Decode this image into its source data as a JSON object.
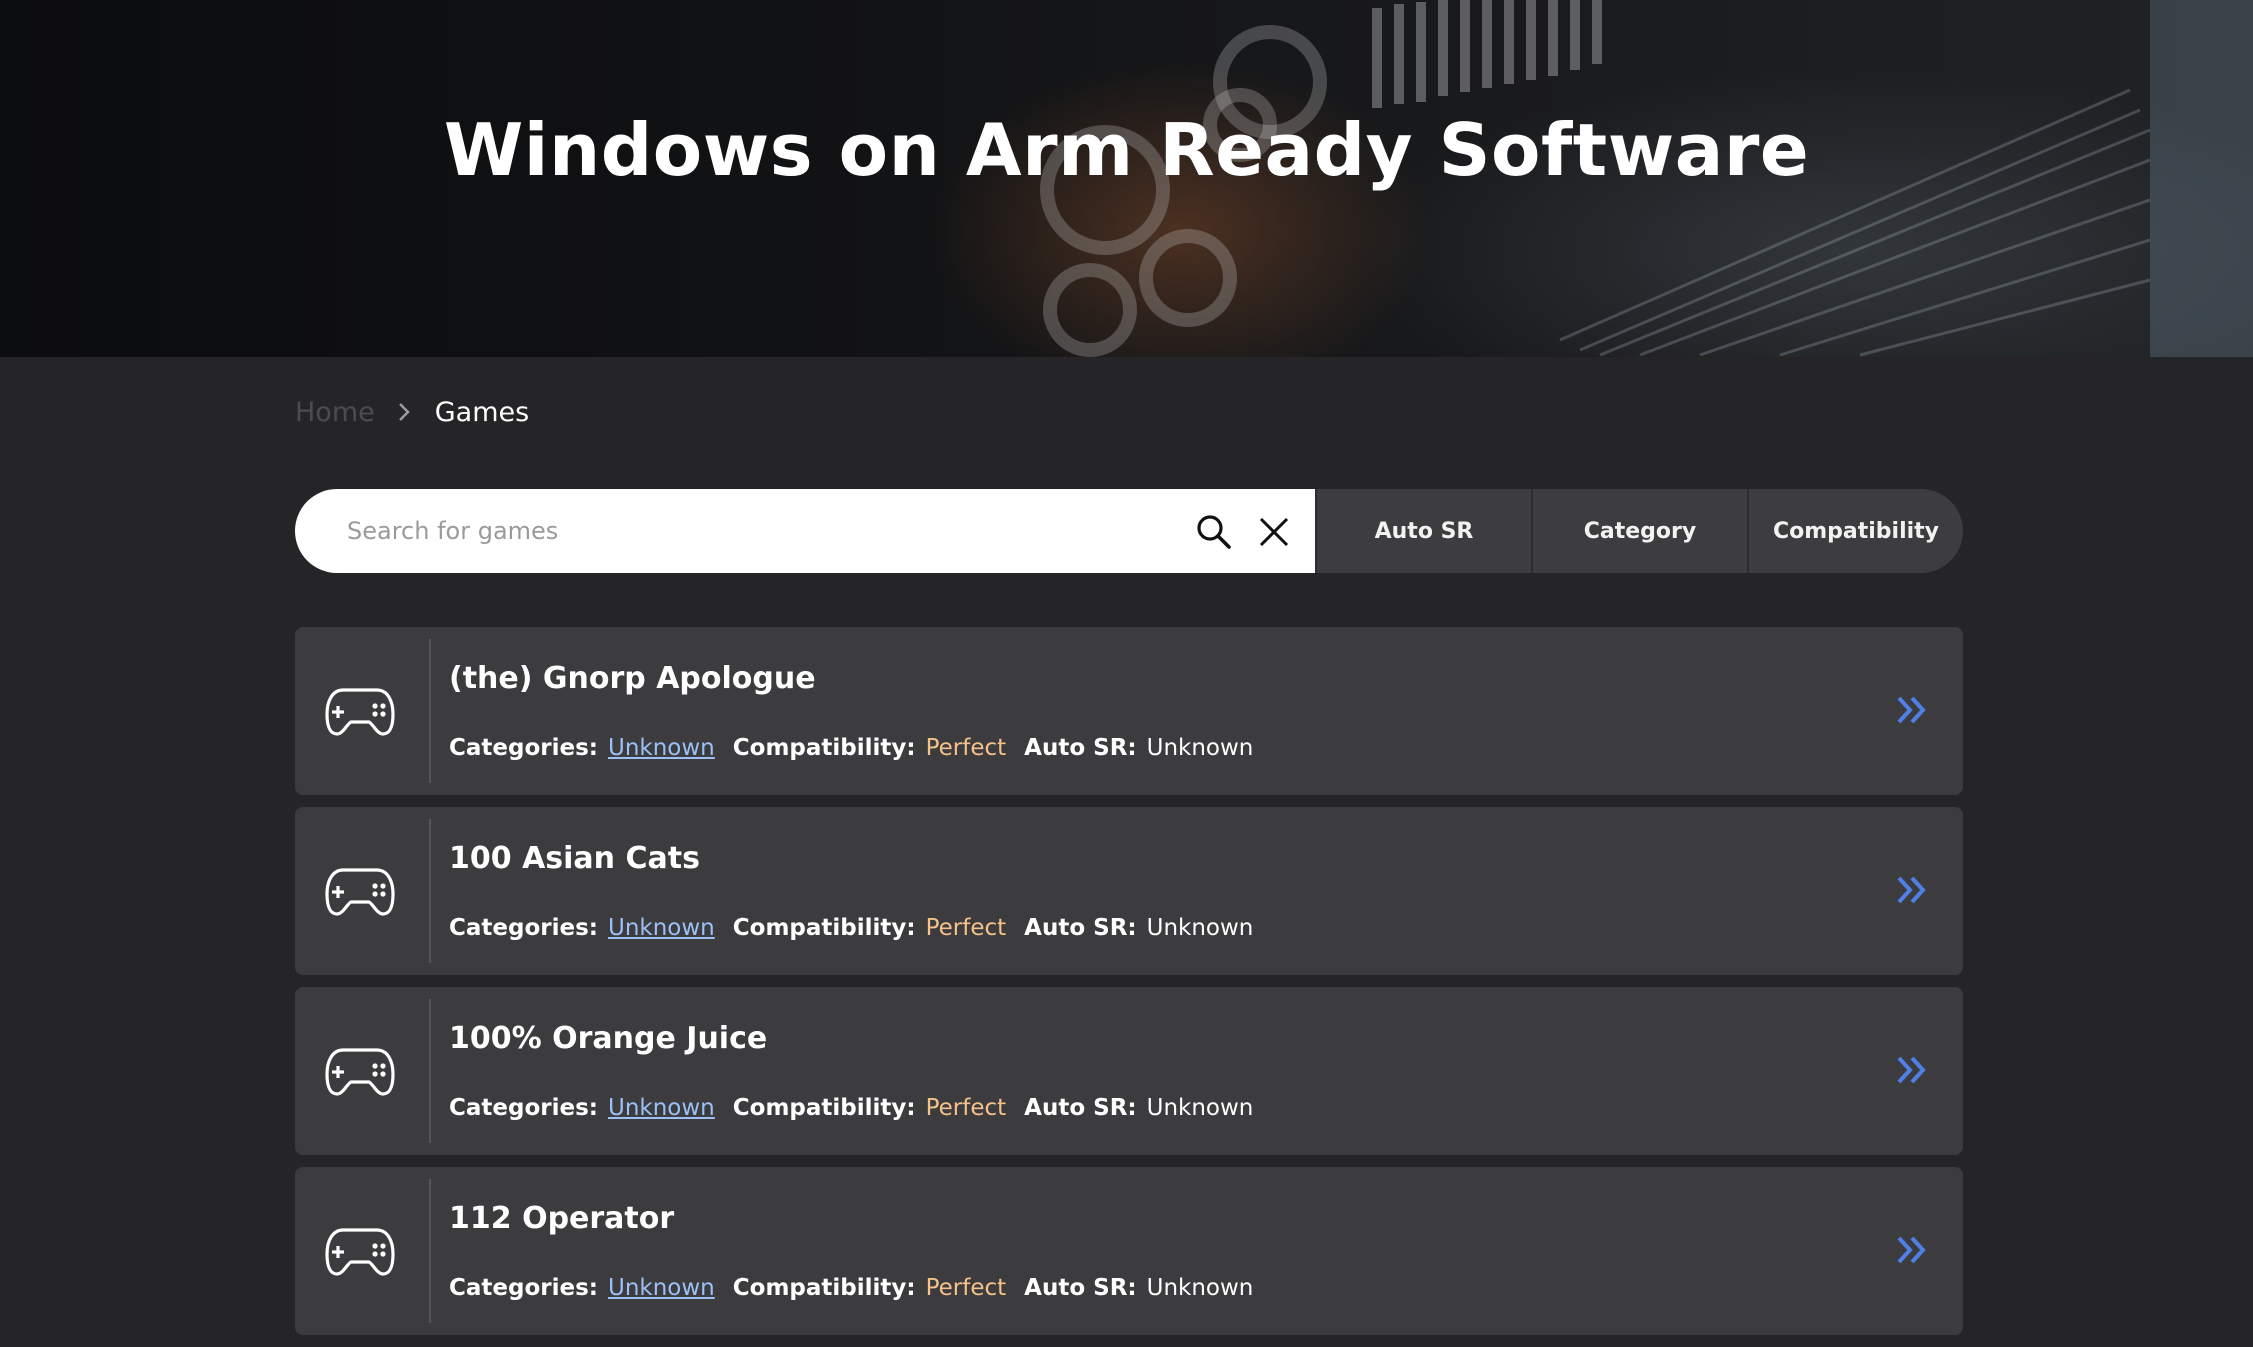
{
  "hero": {
    "title": "Windows on Arm Ready Software"
  },
  "breadcrumb": {
    "home": "Home",
    "current": "Games"
  },
  "search": {
    "placeholder": "Search for games",
    "value": ""
  },
  "filters": {
    "auto_sr": "Auto SR",
    "category": "Category",
    "compatibility": "Compatibility"
  },
  "labels": {
    "categories": "Categories:",
    "compatibility": "Compatibility:",
    "auto_sr": "Auto SR:"
  },
  "games": [
    {
      "title": "(the) Gnorp Apologue",
      "categories": "Unknown",
      "compatibility": "Perfect",
      "auto_sr": "Unknown"
    },
    {
      "title": "100 Asian Cats",
      "categories": "Unknown",
      "compatibility": "Perfect",
      "auto_sr": "Unknown"
    },
    {
      "title": "100% Orange Juice",
      "categories": "Unknown",
      "compatibility": "Perfect",
      "auto_sr": "Unknown"
    },
    {
      "title": "112 Operator",
      "categories": "Unknown",
      "compatibility": "Perfect",
      "auto_sr": "Unknown"
    }
  ],
  "icons": {
    "search": "search-icon",
    "clear": "close-icon",
    "chevron": "chevron-right-icon",
    "game": "gamepad-icon",
    "arrow": "double-chevron-right-icon"
  },
  "colors": {
    "background": "#252527",
    "card": "#3c3c3f",
    "link": "#9cc0f5",
    "compat_perfect": "#f6c18a",
    "accent_arrow": "#4f80e8"
  }
}
